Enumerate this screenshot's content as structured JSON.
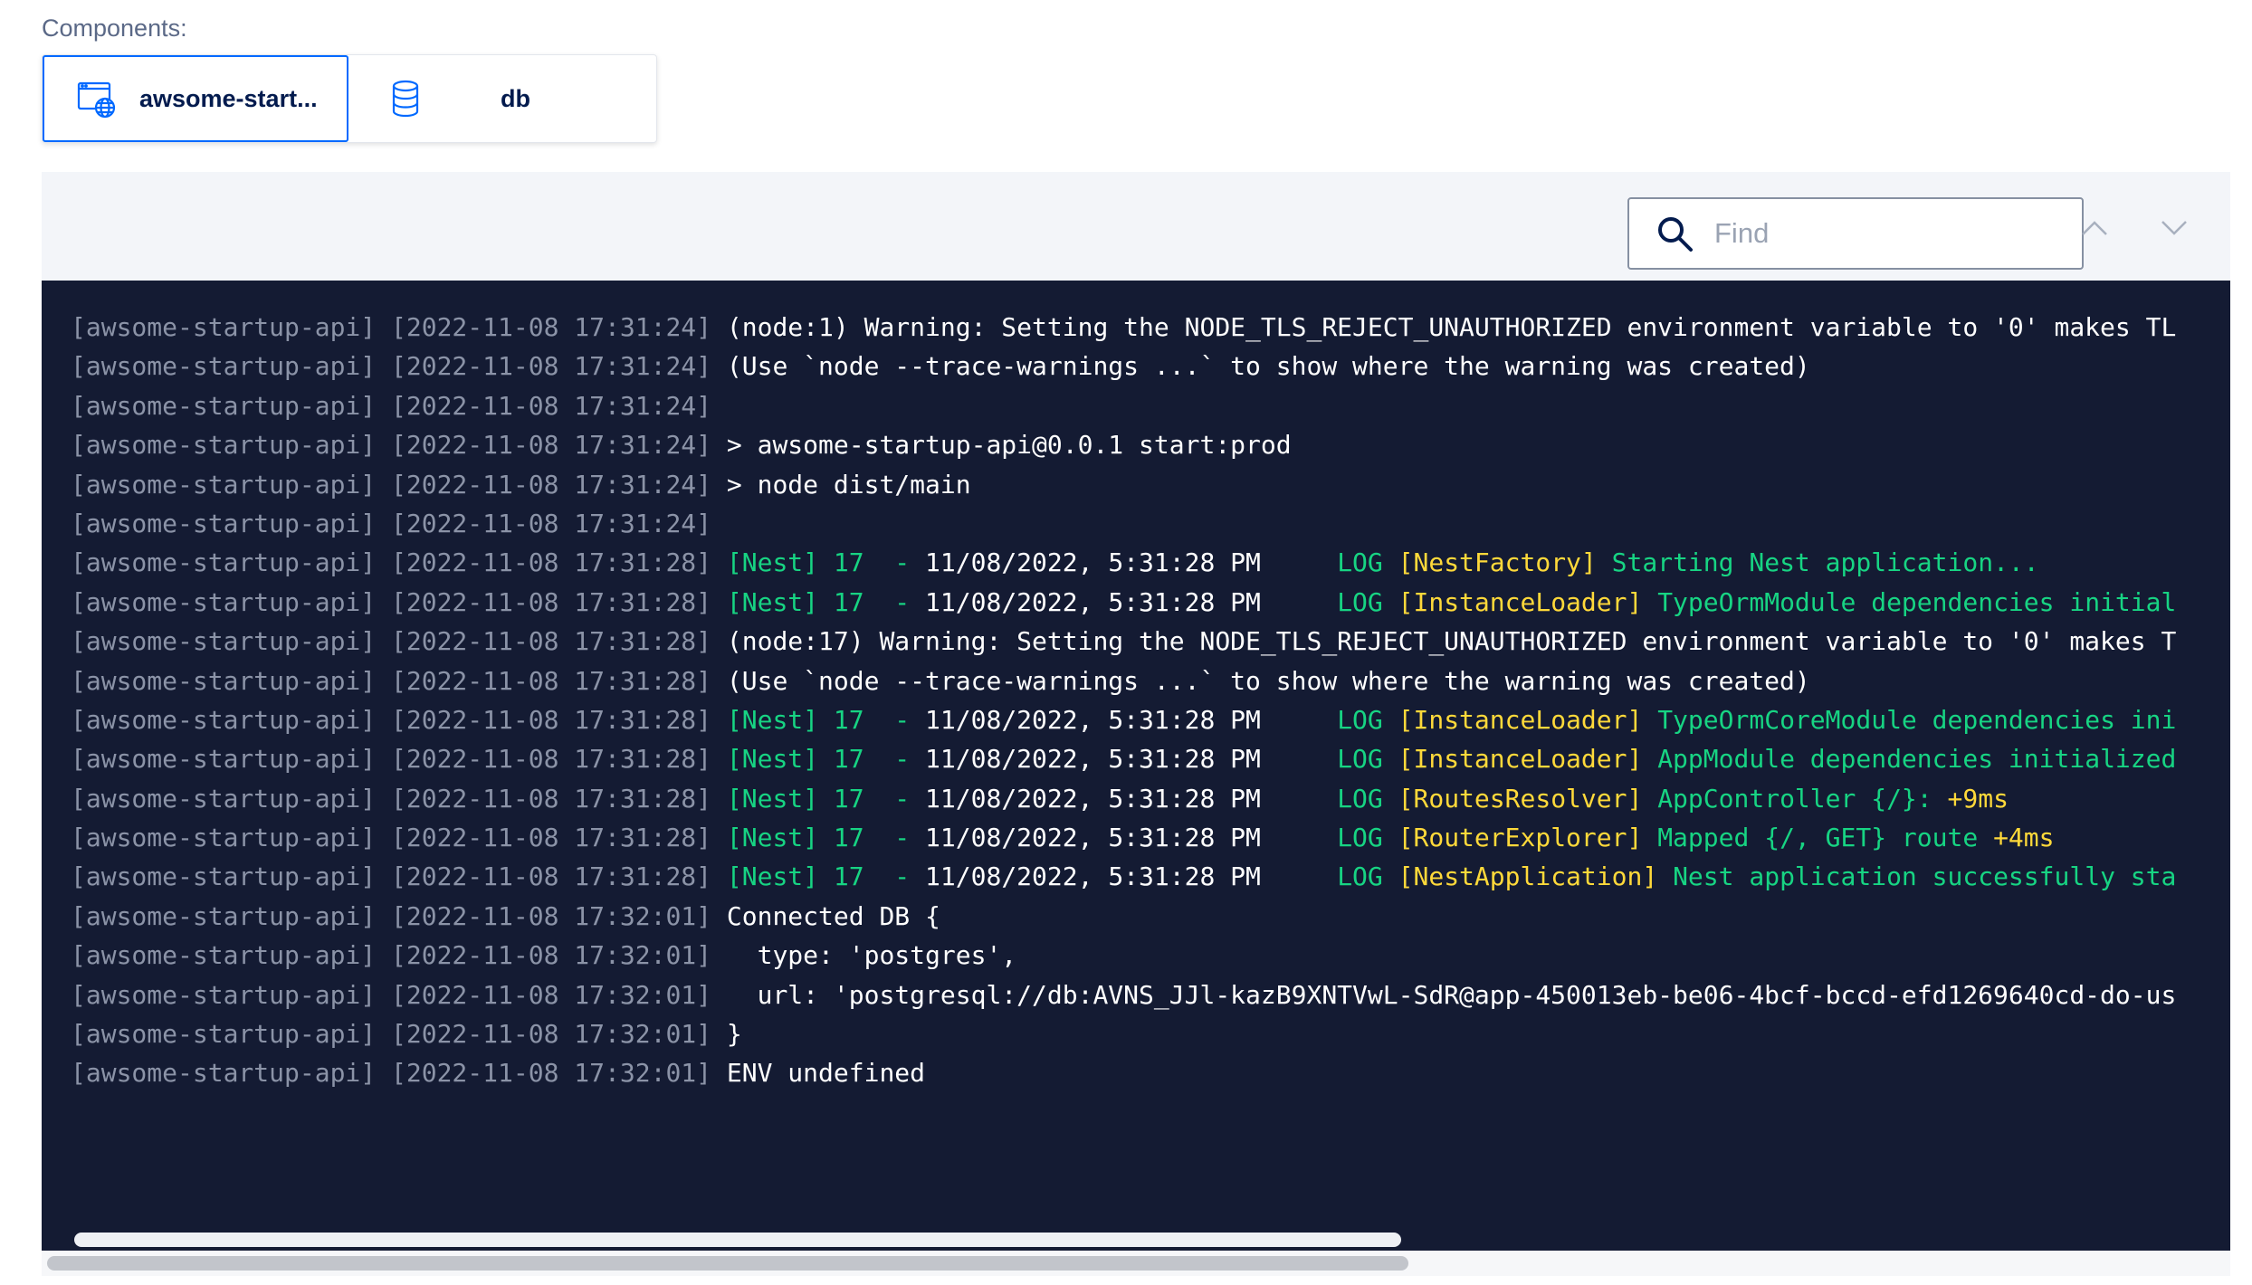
{
  "components": {
    "label": "Components:",
    "tabs": [
      {
        "label": "awsome-start...",
        "icon": "web-service-icon",
        "active": true
      },
      {
        "label": "db",
        "icon": "database-icon",
        "active": false
      }
    ]
  },
  "find": {
    "placeholder": "Find",
    "value": ""
  },
  "colors": {
    "accent": "#0069ff",
    "terminal_bg": "#141b33",
    "prefix": "#8b93a7",
    "green": "#17d483",
    "yellow": "#ffd93a"
  },
  "log_lines": [
    [
      {
        "t": "[awsome-startup-api] [2022-11-08 17:31:24] ",
        "c": "pfx"
      },
      {
        "t": "(node:1) Warning: Setting the NODE_TLS_REJECT_UNAUTHORIZED environment variable to '0' makes TL",
        "c": "white"
      }
    ],
    [
      {
        "t": "[awsome-startup-api] [2022-11-08 17:31:24] ",
        "c": "pfx"
      },
      {
        "t": "(Use `node --trace-warnings ...` to show where the warning was created)",
        "c": "white"
      }
    ],
    [
      {
        "t": "[awsome-startup-api] [2022-11-08 17:31:24]",
        "c": "pfx"
      }
    ],
    [
      {
        "t": "[awsome-startup-api] [2022-11-08 17:31:24] ",
        "c": "pfx"
      },
      {
        "t": "> awsome-startup-api@0.0.1 start:prod",
        "c": "white"
      }
    ],
    [
      {
        "t": "[awsome-startup-api] [2022-11-08 17:31:24] ",
        "c": "pfx"
      },
      {
        "t": "> node dist/main",
        "c": "white"
      }
    ],
    [
      {
        "t": "[awsome-startup-api] [2022-11-08 17:31:24]",
        "c": "pfx"
      }
    ],
    [
      {
        "t": "[awsome-startup-api] [2022-11-08 17:31:28] ",
        "c": "pfx"
      },
      {
        "t": "[Nest] 17  - ",
        "c": "green"
      },
      {
        "t": "11/08/2022, 5:31:28 PM",
        "c": "white"
      },
      {
        "t": "     LOG ",
        "c": "green"
      },
      {
        "t": "[NestFactory] ",
        "c": "yellow"
      },
      {
        "t": "Starting Nest application...",
        "c": "green"
      }
    ],
    [
      {
        "t": "[awsome-startup-api] [2022-11-08 17:31:28] ",
        "c": "pfx"
      },
      {
        "t": "[Nest] 17  - ",
        "c": "green"
      },
      {
        "t": "11/08/2022, 5:31:28 PM",
        "c": "white"
      },
      {
        "t": "     LOG ",
        "c": "green"
      },
      {
        "t": "[InstanceLoader] ",
        "c": "yellow"
      },
      {
        "t": "TypeOrmModule dependencies initial",
        "c": "green"
      }
    ],
    [
      {
        "t": "[awsome-startup-api] [2022-11-08 17:31:28] ",
        "c": "pfx"
      },
      {
        "t": "(node:17) Warning: Setting the NODE_TLS_REJECT_UNAUTHORIZED environment variable to '0' makes T",
        "c": "white"
      }
    ],
    [
      {
        "t": "[awsome-startup-api] [2022-11-08 17:31:28] ",
        "c": "pfx"
      },
      {
        "t": "(Use `node --trace-warnings ...` to show where the warning was created)",
        "c": "white"
      }
    ],
    [
      {
        "t": "[awsome-startup-api] [2022-11-08 17:31:28] ",
        "c": "pfx"
      },
      {
        "t": "[Nest] 17  - ",
        "c": "green"
      },
      {
        "t": "11/08/2022, 5:31:28 PM",
        "c": "white"
      },
      {
        "t": "     LOG ",
        "c": "green"
      },
      {
        "t": "[InstanceLoader] ",
        "c": "yellow"
      },
      {
        "t": "TypeOrmCoreModule dependencies ini",
        "c": "green"
      }
    ],
    [
      {
        "t": "[awsome-startup-api] [2022-11-08 17:31:28] ",
        "c": "pfx"
      },
      {
        "t": "[Nest] 17  - ",
        "c": "green"
      },
      {
        "t": "11/08/2022, 5:31:28 PM",
        "c": "white"
      },
      {
        "t": "     LOG ",
        "c": "green"
      },
      {
        "t": "[InstanceLoader] ",
        "c": "yellow"
      },
      {
        "t": "AppModule dependencies initialized",
        "c": "green"
      }
    ],
    [
      {
        "t": "[awsome-startup-api] [2022-11-08 17:31:28] ",
        "c": "pfx"
      },
      {
        "t": "[Nest] 17  - ",
        "c": "green"
      },
      {
        "t": "11/08/2022, 5:31:28 PM",
        "c": "white"
      },
      {
        "t": "     LOG ",
        "c": "green"
      },
      {
        "t": "[RoutesResolver] ",
        "c": "yellow"
      },
      {
        "t": "AppController {/}: ",
        "c": "green"
      },
      {
        "t": "+9ms",
        "c": "yellow"
      }
    ],
    [
      {
        "t": "[awsome-startup-api] [2022-11-08 17:31:28] ",
        "c": "pfx"
      },
      {
        "t": "[Nest] 17  - ",
        "c": "green"
      },
      {
        "t": "11/08/2022, 5:31:28 PM",
        "c": "white"
      },
      {
        "t": "     LOG ",
        "c": "green"
      },
      {
        "t": "[RouterExplorer] ",
        "c": "yellow"
      },
      {
        "t": "Mapped {/, GET} route ",
        "c": "green"
      },
      {
        "t": "+4ms",
        "c": "yellow"
      }
    ],
    [
      {
        "t": "[awsome-startup-api] [2022-11-08 17:31:28] ",
        "c": "pfx"
      },
      {
        "t": "[Nest] 17  - ",
        "c": "green"
      },
      {
        "t": "11/08/2022, 5:31:28 PM",
        "c": "white"
      },
      {
        "t": "     LOG ",
        "c": "green"
      },
      {
        "t": "[NestApplication] ",
        "c": "yellow"
      },
      {
        "t": "Nest application successfully sta",
        "c": "green"
      }
    ],
    [
      {
        "t": "[awsome-startup-api] [2022-11-08 17:32:01] ",
        "c": "pfx"
      },
      {
        "t": "Connected DB {",
        "c": "white"
      }
    ],
    [
      {
        "t": "[awsome-startup-api] [2022-11-08 17:32:01] ",
        "c": "pfx"
      },
      {
        "t": "  type: 'postgres',",
        "c": "white"
      }
    ],
    [
      {
        "t": "[awsome-startup-api] [2022-11-08 17:32:01] ",
        "c": "pfx"
      },
      {
        "t": "  url: 'postgresql://db:AVNS_JJl-kazB9XNTVwL-SdR@app-450013eb-be06-4bcf-bccd-efd1269640cd-do-us",
        "c": "white"
      }
    ],
    [
      {
        "t": "[awsome-startup-api] [2022-11-08 17:32:01] ",
        "c": "pfx"
      },
      {
        "t": "}",
        "c": "white"
      }
    ],
    [
      {
        "t": "[awsome-startup-api] [2022-11-08 17:32:01] ",
        "c": "pfx"
      },
      {
        "t": "ENV undefined",
        "c": "white"
      }
    ]
  ]
}
